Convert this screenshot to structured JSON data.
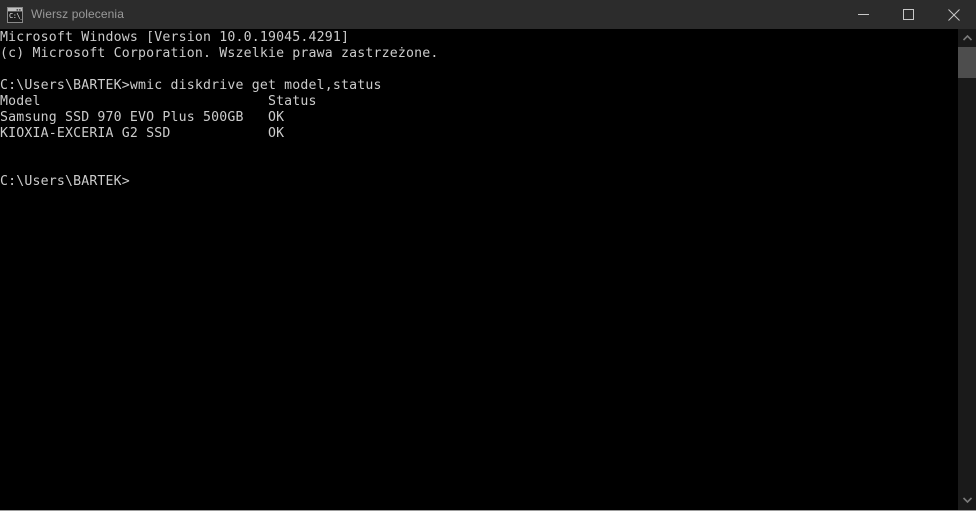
{
  "window": {
    "title": "Wiersz polecenia",
    "icon": "cmd-console-icon",
    "icon_glyph": "C:\\_",
    "titlebar_color": "#2c2c2c",
    "console_bg": "#000000",
    "console_fg": "#cccccc"
  },
  "controls": {
    "minimize_label": "Minimalizuj",
    "maximize_label": "Maksymalizuj",
    "close_label": "Zamknij"
  },
  "console": {
    "lines": [
      "Microsoft Windows [Version 10.0.19045.4291]",
      "(c) Microsoft Corporation. Wszelkie prawa zastrzeżone.",
      "",
      "C:\\Users\\BARTEK>wmic diskdrive get model,status",
      "Model                            Status",
      "Samsung SSD 970 EVO Plus 500GB   OK",
      "KIOXIA-EXCERIA G2 SSD            OK",
      "",
      "",
      "C:\\Users\\BARTEK>"
    ],
    "banner": {
      "os_line": "Microsoft Windows [Version 10.0.19045.4291]",
      "copyright_line": "(c) Microsoft Corporation. Wszelkie prawa zastrzeżone.",
      "version": "10.0.19045.4291"
    },
    "prompt": "C:\\Users\\BARTEK>",
    "command": "wmic diskdrive get model,status",
    "table": {
      "headers": [
        "Model",
        "Status"
      ],
      "rows": [
        [
          "Samsung SSD 970 EVO Plus 500GB",
          "OK"
        ],
        [
          "KIOXIA-EXCERIA G2 SSD",
          "OK"
        ]
      ]
    }
  },
  "scrollbar": {
    "up_arrow": "chevron-up-icon",
    "down_arrow": "chevron-down-icon",
    "thumb_position_percent": 0
  }
}
